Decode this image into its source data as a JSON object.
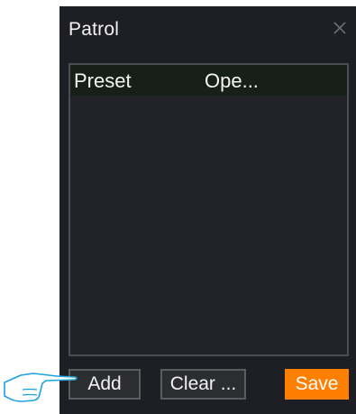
{
  "dialog": {
    "title": "Patrol",
    "close_icon": "close-icon"
  },
  "list": {
    "columns": [
      "Preset",
      "Ope..."
    ],
    "rows": []
  },
  "buttons": {
    "add": "Add",
    "clear": "Clear ...",
    "save": "Save"
  },
  "colors": {
    "dialog_bg": "#1e1f24",
    "header_bg": "#172018",
    "save_bg": "#ff7f00"
  },
  "pointer_icon": "pointing-hand-icon"
}
